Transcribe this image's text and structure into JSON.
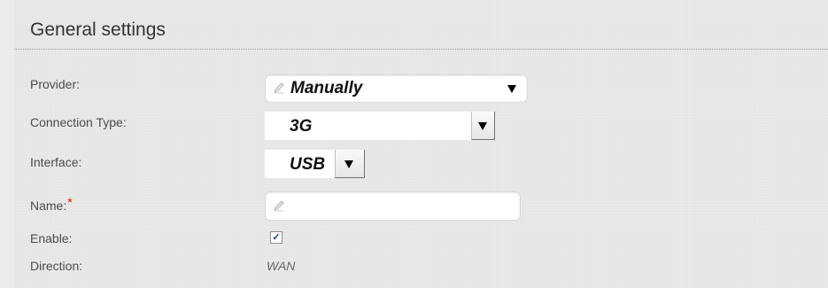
{
  "section": {
    "title": "General settings"
  },
  "form": {
    "provider": {
      "label": "Provider:",
      "value": "Manually"
    },
    "connection_type": {
      "label": "Connection Type:",
      "value": "3G"
    },
    "interface": {
      "label": "Interface:",
      "value": "USB"
    },
    "name": {
      "label": "Name:",
      "required_marker": "*",
      "value": ""
    },
    "enable": {
      "label": "Enable:",
      "checked": true
    },
    "direction": {
      "label": "Direction:",
      "value": "WAN"
    }
  },
  "colors": {
    "required": "#e0121b",
    "checkmark": "#1d3d7a"
  },
  "icons": {
    "field_edit": "pencil-icon",
    "dropdown": "triangle-down-icon",
    "checkbox": "checkmark-icon"
  }
}
